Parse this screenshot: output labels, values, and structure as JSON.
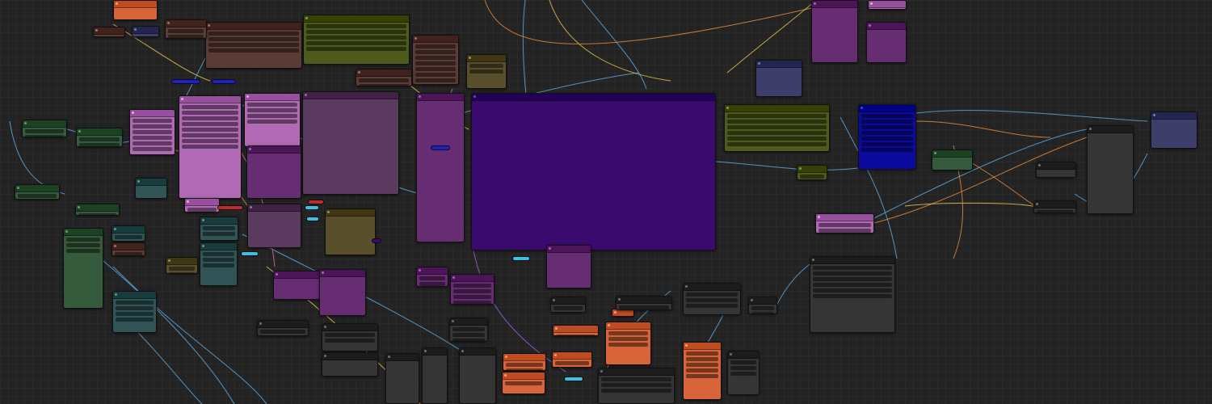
{
  "colors": {
    "canvas": "#232323",
    "node_gray": "#353535",
    "node_olive": "#4f5b1c",
    "node_purple_dark": "#3a0a6e",
    "node_violet": "#b06ab5",
    "node_magenta": "#662d73",
    "node_mauve": "#5b3a5f",
    "node_forest": "#365a3c",
    "node_teal": "#315456",
    "node_orange": "#d8653a",
    "node_brown": "#5b3b36",
    "node_blue": "#0b0a9e",
    "node_slate": "#3d3e69",
    "node_khaki": "#5a4f2b",
    "wire_blue": "#5fa6d9",
    "wire_yellow": "#e9c14a",
    "wire_orange": "#e08a3c",
    "wire_pink": "#d86aa7",
    "wire_purple": "#9a5fd6",
    "reroute_cyan": "#39c2e6",
    "reroute_red": "#c12a2a"
  },
  "nodes": [
    {
      "kind": "node",
      "color": "#3a0a6e",
      "rows": 0
    },
    {
      "kind": "node",
      "color": "#5b3a5f",
      "rows": 0
    },
    {
      "kind": "node",
      "color": "#4f5b1c",
      "rows": 5
    },
    {
      "kind": "node",
      "color": "#4f5b1c",
      "rows": 6
    },
    {
      "kind": "node",
      "color": "#0b0a9e",
      "rows": 7
    },
    {
      "kind": "node",
      "color": "#b06ab5",
      "rows": 6
    },
    {
      "kind": "node",
      "color": "#b06ab5",
      "rows": 8
    },
    {
      "kind": "node",
      "color": "#b06ab5",
      "rows": 4
    },
    {
      "kind": "node",
      "color": "#b06ab5",
      "rows": 3
    },
    {
      "kind": "node",
      "color": "#b06ab5",
      "rows": 2
    },
    {
      "kind": "node",
      "color": "#662d73",
      "rows": 0
    },
    {
      "kind": "node",
      "color": "#662d73",
      "rows": 0
    },
    {
      "kind": "node",
      "color": "#662d73",
      "rows": 0
    },
    {
      "kind": "node",
      "color": "#662d73",
      "rows": 0
    },
    {
      "kind": "node",
      "color": "#662d73",
      "rows": 0
    },
    {
      "kind": "node",
      "color": "#662d73",
      "rows": 6
    },
    {
      "kind": "node",
      "color": "#662d73",
      "rows": 3
    },
    {
      "kind": "node",
      "color": "#5b3a5f",
      "rows": 0
    },
    {
      "kind": "node",
      "color": "#5a4f2b",
      "rows": 0
    },
    {
      "kind": "node",
      "color": "#5a4f2b",
      "rows": 2
    },
    {
      "kind": "node",
      "color": "#5a4f2b",
      "rows": 2
    },
    {
      "kind": "node",
      "color": "#365a3c",
      "rows": 0
    },
    {
      "kind": "node",
      "color": "#365a3c",
      "rows": 3
    },
    {
      "kind": "node",
      "color": "#365a3c",
      "rows": 2
    },
    {
      "kind": "node",
      "color": "#365a3c",
      "rows": 3
    },
    {
      "kind": "node",
      "color": "#365a3c",
      "rows": 2
    },
    {
      "kind": "node",
      "color": "#365a3c",
      "rows": 2
    },
    {
      "kind": "node",
      "color": "#315456",
      "rows": 0
    },
    {
      "kind": "node",
      "color": "#315456",
      "rows": 4
    },
    {
      "kind": "node",
      "color": "#315456",
      "rows": 4
    },
    {
      "kind": "node",
      "color": "#315456",
      "rows": 2
    },
    {
      "kind": "node",
      "color": "#315456",
      "rows": 3
    },
    {
      "kind": "node",
      "color": "#5b3b36",
      "rows": 7
    },
    {
      "kind": "node",
      "color": "#5b3b36",
      "rows": 9
    },
    {
      "kind": "node",
      "color": "#5b3b36",
      "rows": 4
    },
    {
      "kind": "node",
      "color": "#5b3b36",
      "rows": 3
    },
    {
      "kind": "node",
      "color": "#5b3b36",
      "rows": 2
    },
    {
      "kind": "node",
      "color": "#5b3b36",
      "rows": 3
    },
    {
      "kind": "node",
      "color": "#d8653a",
      "rows": 0
    },
    {
      "kind": "node",
      "color": "#d8653a",
      "rows": 5
    },
    {
      "kind": "node",
      "color": "#d8653a",
      "rows": 3
    },
    {
      "kind": "node",
      "color": "#d8653a",
      "rows": 2
    },
    {
      "kind": "node",
      "color": "#d8653a",
      "rows": 3
    },
    {
      "kind": "node",
      "color": "#d8653a",
      "rows": 1
    },
    {
      "kind": "node",
      "color": "#d8653a",
      "rows": 1
    },
    {
      "kind": "node",
      "color": "#d8653a",
      "rows": 1
    },
    {
      "kind": "node",
      "color": "#3d3e69",
      "rows": 0
    },
    {
      "kind": "node",
      "color": "#3d3e69",
      "rows": 0
    },
    {
      "kind": "node",
      "color": "#3d3e69",
      "rows": 0
    },
    {
      "kind": "node",
      "color": "#662d73",
      "rows": 0
    },
    {
      "kind": "node",
      "color": "#662d73",
      "rows": 0
    },
    {
      "kind": "node",
      "color": "#b06ab5",
      "rows": 2
    },
    {
      "kind": "node",
      "color": "#4f5b1c",
      "rows": 2
    },
    {
      "kind": "node",
      "color": "#353535",
      "rows": 0
    },
    {
      "kind": "node",
      "color": "#353535",
      "rows": 6
    },
    {
      "kind": "node",
      "color": "#353535",
      "rows": 3
    },
    {
      "kind": "node",
      "color": "#353535",
      "rows": 3
    },
    {
      "kind": "node",
      "color": "#353535",
      "rows": 2
    },
    {
      "kind": "node",
      "color": "#353535",
      "rows": 4
    },
    {
      "kind": "node",
      "color": "#353535",
      "rows": 2
    },
    {
      "kind": "node",
      "color": "#353535",
      "rows": 0
    },
    {
      "kind": "node",
      "color": "#353535",
      "rows": 0
    },
    {
      "kind": "node",
      "color": "#353535",
      "rows": 0
    },
    {
      "kind": "node",
      "color": "#353535",
      "rows": 0
    },
    {
      "kind": "node",
      "color": "#353535",
      "rows": 3
    },
    {
      "kind": "node",
      "color": "#353535",
      "rows": 3
    },
    {
      "kind": "node",
      "color": "#353535",
      "rows": 2
    },
    {
      "kind": "node",
      "color": "#353535",
      "rows": 0
    },
    {
      "kind": "node",
      "color": "#353535",
      "rows": 3
    },
    {
      "kind": "node",
      "color": "#353535",
      "rows": 2
    }
  ]
}
